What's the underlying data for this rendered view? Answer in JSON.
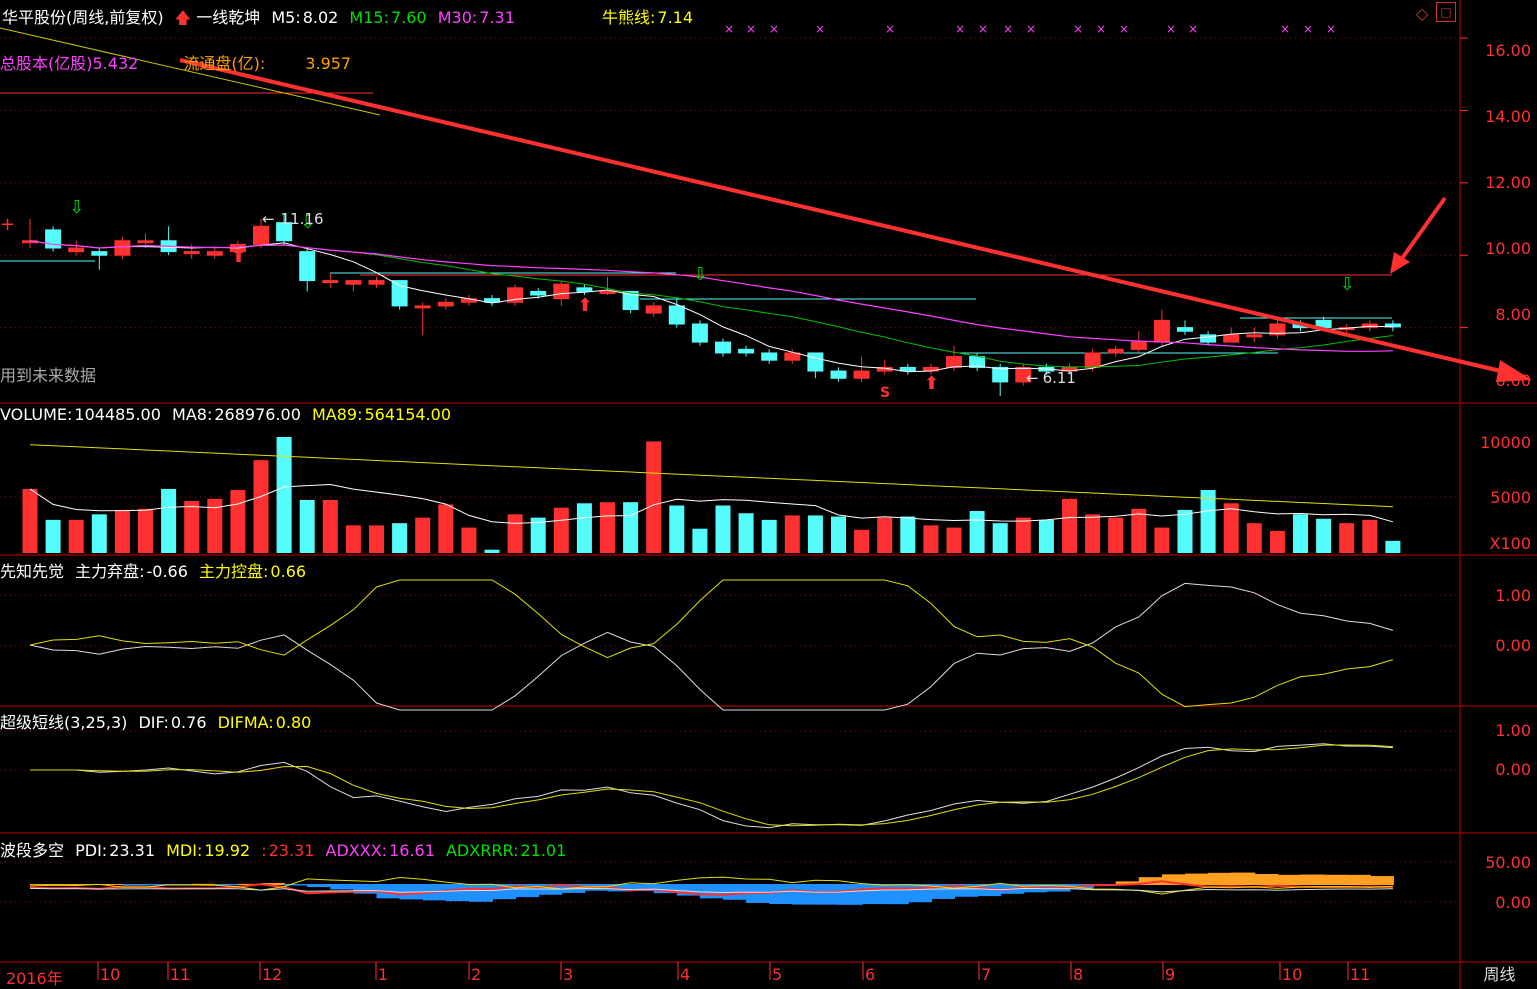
{
  "header": {
    "stock": "华平股份(周线,前复权)",
    "indicator_name": "一线乾坤",
    "m5_label": "M5:",
    "m5_value": "8.02",
    "m15_label": "M15:",
    "m15_value": "7.60",
    "m30_label": "M30:",
    "m30_value": "7.31",
    "bull_bear_label": "牛熊线:",
    "bull_bear_value": "7.14",
    "total_shares_label": "总股本(亿股)",
    "total_shares_value": "5.432",
    "float_shares_label": "流通盘(亿):",
    "float_shares_value": "3.957",
    "future_data_note": "用到未来数据"
  },
  "annotations": {
    "high": "11.16",
    "low": "6.11",
    "signal": "S"
  },
  "price_axis": [
    "16.00",
    "14.00",
    "12.00",
    "10.00",
    "8.00",
    "6.00"
  ],
  "volume": {
    "label": "VOLUME:",
    "value": "104485.00",
    "ma8_label": "MA8:",
    "ma8_value": "268976.00",
    "ma89_label": "MA89:",
    "ma89_value": "564154.00",
    "axis": [
      "10000",
      "5000"
    ],
    "unit": "X100"
  },
  "xzxj": {
    "name": "先知先觉",
    "abandon_label": "主力弃盘:",
    "abandon_value": "-0.66",
    "control_label": "主力控盘:",
    "control_value": "0.66",
    "axis": [
      "1.00",
      "0.00"
    ]
  },
  "cjdx": {
    "name": "超级短线(3,25,3)",
    "dif_label": "DIF:",
    "dif_value": "0.76",
    "difma_label": "DIFMA:",
    "difma_value": "0.80",
    "axis": [
      "1.00",
      "0.00"
    ]
  },
  "bdk": {
    "name": "波段多空",
    "pdi_label": "PDI:",
    "pdi_value": "23.31",
    "mdi_label": "MDI:",
    "mdi_value": "19.92",
    "extra_label": ":",
    "extra_value": "23.31",
    "adxxx_label": "ADXXX:",
    "adxxx_value": "16.61",
    "adxrrr_label": "ADXRRR:",
    "adxrrr_value": "21.01",
    "axis": [
      "50.00",
      "0.00"
    ]
  },
  "x_axis": [
    "2016年",
    "10",
    "11",
    "12",
    "1",
    "2",
    "3",
    "4",
    "5",
    "6",
    "7",
    "8",
    "9",
    "10",
    "11"
  ],
  "period_label": "周线",
  "colors": {
    "up": "#ff3030",
    "down": "#54fcfc",
    "m5": "#ffffff",
    "m15": "#00c000",
    "m30": "#ff40ff",
    "grid": "#a00000"
  },
  "chart_data": {
    "type": "candlestick",
    "title": "华平股份(周线,前复权)",
    "candles": [
      {
        "o": 10.4,
        "c": 10.4,
        "h": 11.0,
        "l": 10.2
      },
      {
        "o": 10.7,
        "c": 10.2,
        "h": 10.8,
        "l": 10.1
      },
      {
        "o": 10.1,
        "c": 10.2,
        "h": 10.4,
        "l": 10.0
      },
      {
        "o": 10.1,
        "c": 10.0,
        "h": 10.2,
        "l": 9.6
      },
      {
        "o": 10.0,
        "c": 10.4,
        "h": 10.5,
        "l": 9.9
      },
      {
        "o": 10.4,
        "c": 10.4,
        "h": 10.6,
        "l": 10.2
      },
      {
        "o": 10.4,
        "c": 10.1,
        "h": 10.8,
        "l": 10.0
      },
      {
        "o": 10.1,
        "c": 10.1,
        "h": 10.3,
        "l": 9.9
      },
      {
        "o": 10.0,
        "c": 10.1,
        "h": 10.2,
        "l": 9.9
      },
      {
        "o": 10.1,
        "c": 10.3,
        "h": 10.4,
        "l": 10.0
      },
      {
        "o": 10.3,
        "c": 10.8,
        "h": 11.0,
        "l": 10.2
      },
      {
        "o": 10.9,
        "c": 10.4,
        "h": 11.16,
        "l": 10.3
      },
      {
        "o": 10.1,
        "c": 9.3,
        "h": 10.2,
        "l": 9.0
      },
      {
        "o": 9.3,
        "c": 9.3,
        "h": 9.5,
        "l": 9.1
      },
      {
        "o": 9.2,
        "c": 9.3,
        "h": 9.3,
        "l": 9.0
      },
      {
        "o": 9.2,
        "c": 9.3,
        "h": 9.4,
        "l": 9.1
      },
      {
        "o": 9.3,
        "c": 8.6,
        "h": 9.3,
        "l": 8.5
      },
      {
        "o": 8.6,
        "c": 8.6,
        "h": 8.7,
        "l": 7.8
      },
      {
        "o": 8.6,
        "c": 8.7,
        "h": 8.8,
        "l": 8.5
      },
      {
        "o": 8.7,
        "c": 8.8,
        "h": 8.9,
        "l": 8.6
      },
      {
        "o": 8.8,
        "c": 8.7,
        "h": 8.9,
        "l": 8.6
      },
      {
        "o": 8.7,
        "c": 9.1,
        "h": 9.2,
        "l": 8.6
      },
      {
        "o": 9.0,
        "c": 8.9,
        "h": 9.1,
        "l": 8.8
      },
      {
        "o": 8.8,
        "c": 9.2,
        "h": 9.3,
        "l": 8.6
      },
      {
        "o": 9.1,
        "c": 9.0,
        "h": 9.2,
        "l": 8.9
      },
      {
        "o": 9.0,
        "c": 9.0,
        "h": 9.4,
        "l": 8.9
      },
      {
        "o": 9.0,
        "c": 8.5,
        "h": 9.0,
        "l": 8.4
      },
      {
        "o": 8.4,
        "c": 8.6,
        "h": 8.7,
        "l": 8.3
      },
      {
        "o": 8.6,
        "c": 8.1,
        "h": 8.8,
        "l": 8.0
      },
      {
        "o": 8.1,
        "c": 7.6,
        "h": 8.2,
        "l": 7.5
      },
      {
        "o": 7.6,
        "c": 7.3,
        "h": 7.7,
        "l": 7.2
      },
      {
        "o": 7.4,
        "c": 7.3,
        "h": 7.5,
        "l": 7.2
      },
      {
        "o": 7.3,
        "c": 7.1,
        "h": 7.4,
        "l": 7.0
      },
      {
        "o": 7.1,
        "c": 7.3,
        "h": 7.4,
        "l": 7.0
      },
      {
        "o": 7.3,
        "c": 6.8,
        "h": 7.3,
        "l": 6.6
      },
      {
        "o": 6.8,
        "c": 6.6,
        "h": 6.9,
        "l": 6.5
      },
      {
        "o": 6.6,
        "c": 6.8,
        "h": 7.2,
        "l": 6.5
      },
      {
        "o": 6.8,
        "c": 6.9,
        "h": 7.1,
        "l": 6.7
      },
      {
        "o": 6.9,
        "c": 6.8,
        "h": 7.0,
        "l": 6.7
      },
      {
        "o": 6.8,
        "c": 6.9,
        "h": 7.0,
        "l": 6.7
      },
      {
        "o": 6.9,
        "c": 7.2,
        "h": 7.5,
        "l": 6.8
      },
      {
        "o": 7.2,
        "c": 6.9,
        "h": 7.3,
        "l": 6.8
      },
      {
        "o": 6.9,
        "c": 6.5,
        "h": 7.0,
        "l": 6.11
      },
      {
        "o": 6.5,
        "c": 6.9,
        "h": 7.0,
        "l": 6.4
      },
      {
        "o": 6.9,
        "c": 6.8,
        "h": 7.0,
        "l": 6.7
      },
      {
        "o": 6.8,
        "c": 6.9,
        "h": 7.0,
        "l": 6.7
      },
      {
        "o": 6.9,
        "c": 7.3,
        "h": 7.4,
        "l": 6.8
      },
      {
        "o": 7.3,
        "c": 7.4,
        "h": 7.5,
        "l": 7.2
      },
      {
        "o": 7.4,
        "c": 7.6,
        "h": 7.9,
        "l": 7.3
      },
      {
        "o": 7.6,
        "c": 8.2,
        "h": 8.5,
        "l": 7.5
      },
      {
        "o": 8.0,
        "c": 7.9,
        "h": 8.2,
        "l": 7.8
      },
      {
        "o": 7.8,
        "c": 7.6,
        "h": 7.9,
        "l": 7.5
      },
      {
        "o": 7.6,
        "c": 7.8,
        "h": 8.0,
        "l": 7.6
      },
      {
        "o": 7.8,
        "c": 7.8,
        "h": 8.0,
        "l": 7.6
      },
      {
        "o": 7.8,
        "c": 8.1,
        "h": 8.2,
        "l": 7.7
      },
      {
        "o": 8.1,
        "c": 8.0,
        "h": 8.2,
        "l": 7.9
      },
      {
        "o": 8.2,
        "c": 8.0,
        "h": 8.3,
        "l": 7.9
      },
      {
        "o": 8.0,
        "c": 8.0,
        "h": 8.1,
        "l": 7.8
      },
      {
        "o": 8.0,
        "c": 8.1,
        "h": 8.2,
        "l": 7.9
      },
      {
        "o": 8.1,
        "c": 8.02,
        "h": 8.2,
        "l": 7.9
      }
    ],
    "volume_x100": [
      5800,
      3000,
      3000,
      3500,
      3900,
      4000,
      5800,
      4700,
      4900,
      5700,
      8400,
      10500,
      4800,
      4800,
      2500,
      2500,
      2700,
      3200,
      4400,
      2300,
      300,
      3500,
      3200,
      4100,
      4500,
      4600,
      4600,
      10100,
      4300,
      2200,
      4300,
      3600,
      3000,
      3400,
      3400,
      3300,
      2100,
      3200,
      3300,
      2500,
      2300,
      3800,
      2700,
      3200,
      3000,
      4900,
      3500,
      3200,
      4000,
      2300,
      3900,
      5700,
      4500,
      2700,
      2000,
      3500,
      3100,
      2700,
      3000,
      1100
    ],
    "price_ylim": [
      6.0,
      16.5
    ]
  }
}
